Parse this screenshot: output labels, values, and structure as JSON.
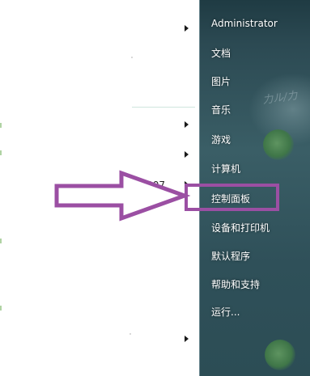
{
  "left_panel": {
    "partial_program_label": "d 2007"
  },
  "right_panel": {
    "items": [
      {
        "label": "Administrator"
      },
      {
        "label": "文档"
      },
      {
        "label": "图片"
      },
      {
        "label": "音乐"
      },
      {
        "label": "游戏"
      },
      {
        "label": "计算机"
      },
      {
        "label": "控制面板"
      },
      {
        "label": "设备和打印机"
      },
      {
        "label": "默认程序"
      },
      {
        "label": "帮助和支持"
      },
      {
        "label": "运行..."
      }
    ]
  },
  "annotation": {
    "arrow_color": "#9b4fa3",
    "highlight_color": "#9b4fa3",
    "highlighted_item": "控制面板"
  },
  "icons": [
    "submenu-arrow-icon",
    "annotation-arrow-icon"
  ]
}
